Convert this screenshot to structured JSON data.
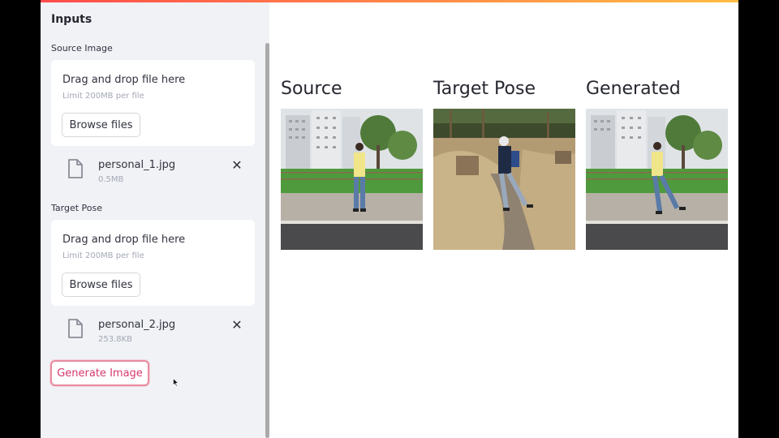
{
  "sidebar": {
    "heading": "Inputs",
    "source": {
      "label": "Source Image",
      "dropzone_title": "Drag and drop file here",
      "dropzone_limit": "Limit 200MB per file",
      "browse_label": "Browse files",
      "file_name": "personal_1.jpg",
      "file_size": "0.5MB"
    },
    "target": {
      "label": "Target Pose",
      "dropzone_title": "Drag and drop file here",
      "dropzone_limit": "Limit 200MB per file",
      "browse_label": "Browse files",
      "file_name": "personal_2.jpg",
      "file_size": "253.8KB"
    },
    "generate_label": "Generate Image",
    "close_glyph": "✕"
  },
  "main": {
    "columns": [
      {
        "title": "Source"
      },
      {
        "title": "Target Pose"
      },
      {
        "title": "Generated"
      }
    ]
  },
  "colors": {
    "accent": "#ff4b4b",
    "generate_border": "#e98ba1",
    "generate_text": "#d5386b",
    "sidebar_bg": "#f0f2f6"
  },
  "icons": {
    "file": "file-icon",
    "close": "close-icon",
    "cursor": "mouse-cursor-icon"
  }
}
